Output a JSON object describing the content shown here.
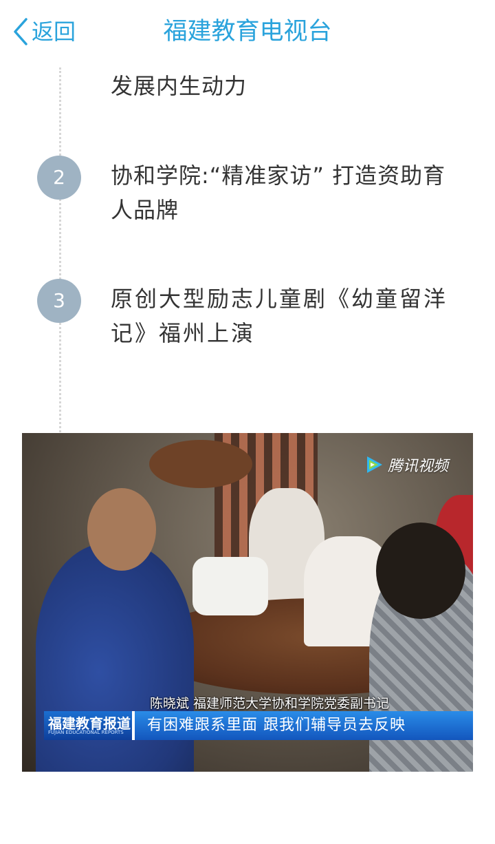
{
  "header": {
    "back_label": "返回",
    "title": "福建教育电视台"
  },
  "list": {
    "items": [
      {
        "number": "",
        "text": "发展内生动力"
      },
      {
        "number": "2",
        "text": "协和学院:“精准家访” 打造资助育人品牌"
      },
      {
        "number": "3",
        "text": "原创大型励志儿童剧《幼童留洋记》福州上演"
      }
    ]
  },
  "video": {
    "watermark": "腾讯视频",
    "speaker_caption": "陈晓斌  福建师范大学协和学院党委副书记",
    "program_logo": "福建教育报道",
    "program_logo_sub": "FUJIAN EDUCATIONAL REPORTS",
    "subtitle": "有困难跟系里面 跟我们辅导员去反映"
  },
  "colors": {
    "accent": "#2aa3dc",
    "badge": "#9fb3c3",
    "text": "#333333"
  }
}
